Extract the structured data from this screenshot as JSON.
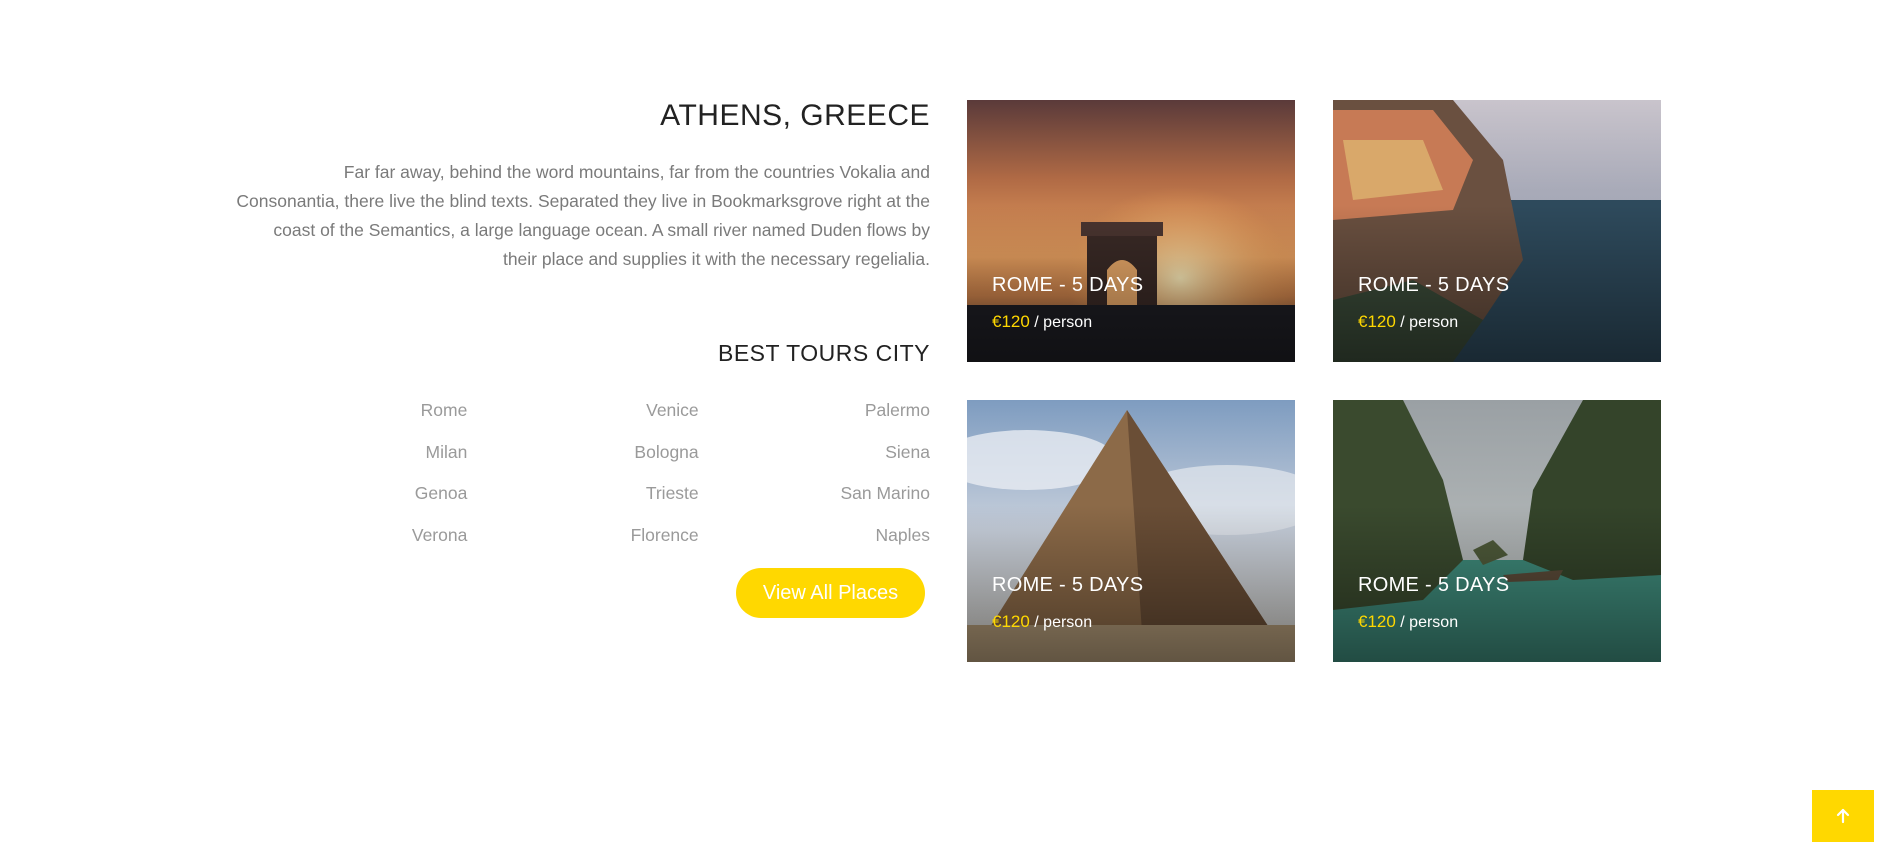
{
  "about": {
    "title": "ATHENS, GREECE",
    "description": "Far far away, behind the word mountains, far from the countries Vokalia and Consonantia, there live the blind texts. Separated they live in Bookmarksgrove right at the coast of the Semantics, a large language ocean. A small river named Duden flows by their place and supplies it with the necessary regelialia.",
    "subtitle": "BEST TOURS CITY",
    "cities": [
      "Rome",
      "Venice",
      "Palermo",
      "Milan",
      "Bologna",
      "Siena",
      "Genoa",
      "Trieste",
      "San Marino",
      "Verona",
      "Florence",
      "Naples"
    ],
    "button_label": "View All Places"
  },
  "tours": [
    {
      "title": "ROME - 5 DAYS",
      "price": "€120",
      "unit": "/ person",
      "image": "arc-de-triomphe-sunset"
    },
    {
      "title": "ROME - 5 DAYS",
      "price": "€120",
      "unit": "/ person",
      "image": "cinque-terre-coast"
    },
    {
      "title": "ROME - 5 DAYS",
      "price": "€120",
      "unit": "/ person",
      "image": "pyramid-desert"
    },
    {
      "title": "ROME - 5 DAYS",
      "price": "€120",
      "unit": "/ person",
      "image": "tropical-lagoon-boats"
    }
  ],
  "colors": {
    "accent": "#ffd800",
    "heading": "#222222",
    "text": "#7a7a7a"
  },
  "icons": {
    "scroll_top": "arrow-up-icon"
  }
}
